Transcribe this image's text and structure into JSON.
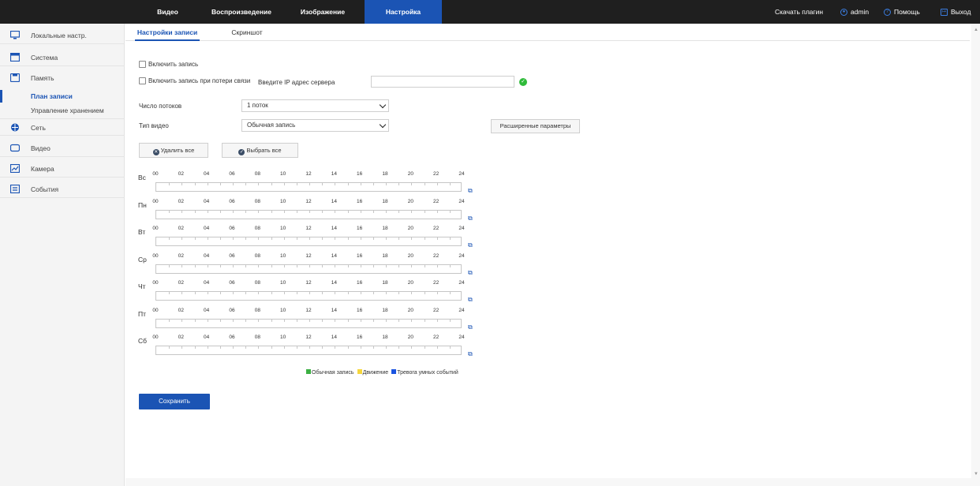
{
  "topnav": {
    "items": [
      "Видео",
      "Воспроизведение",
      "Изображение",
      "Настройка"
    ],
    "active": "Настройка",
    "download_plugin": "Скачать плагин",
    "user": "admin",
    "help": "Помощь",
    "logout": "Выход"
  },
  "sidebar": {
    "items": [
      {
        "label": "Локальные настр.",
        "icon": "monitor-icon"
      },
      {
        "label": "Система",
        "icon": "system-icon"
      },
      {
        "label": "Память",
        "icon": "storage-icon"
      },
      {
        "label": "Сеть",
        "icon": "network-icon"
      },
      {
        "label": "Видео",
        "icon": "video-icon"
      },
      {
        "label": "Камера",
        "icon": "camera-icon"
      },
      {
        "label": "События",
        "icon": "events-icon"
      }
    ],
    "sub_items": [
      "План записи",
      "Управление хранением"
    ],
    "active_sub": "План записи"
  },
  "tabs": [
    "Настройки записи",
    "Скриншот"
  ],
  "form": {
    "enable_record": "Включить запись",
    "enable_record_on_loss": "Включить запись при потери связи",
    "server_ip_label": "Введите IP адрес сервера",
    "server_ip_value": "",
    "streams_label": "Число потоков",
    "streams_value": "1 поток",
    "video_type_label": "Тип видео",
    "video_type_value": "Обычная запись",
    "advanced_button": "Расширенные параметры",
    "delete_all_button": "Удалить все",
    "select_all_button": "Выбрать все"
  },
  "schedule": {
    "days": [
      "Вс",
      "Пн",
      "Вт",
      "Ср",
      "Чт",
      "Пт",
      "Сб"
    ],
    "hours": [
      "00",
      "02",
      "04",
      "06",
      "08",
      "10",
      "12",
      "14",
      "16",
      "18",
      "20",
      "22",
      "24"
    ]
  },
  "legend": [
    {
      "label": "Обычная запись",
      "color": "#3cb043"
    },
    {
      "label": "Движение",
      "color": "#f5d63d"
    },
    {
      "label": "Тревога умных событий",
      "color": "#1b54e0"
    }
  ],
  "save_button": "Сохранить",
  "colors": {
    "accent": "#1b54b4",
    "topbar": "#1f1f1f",
    "ok": "#2fbb3a"
  }
}
